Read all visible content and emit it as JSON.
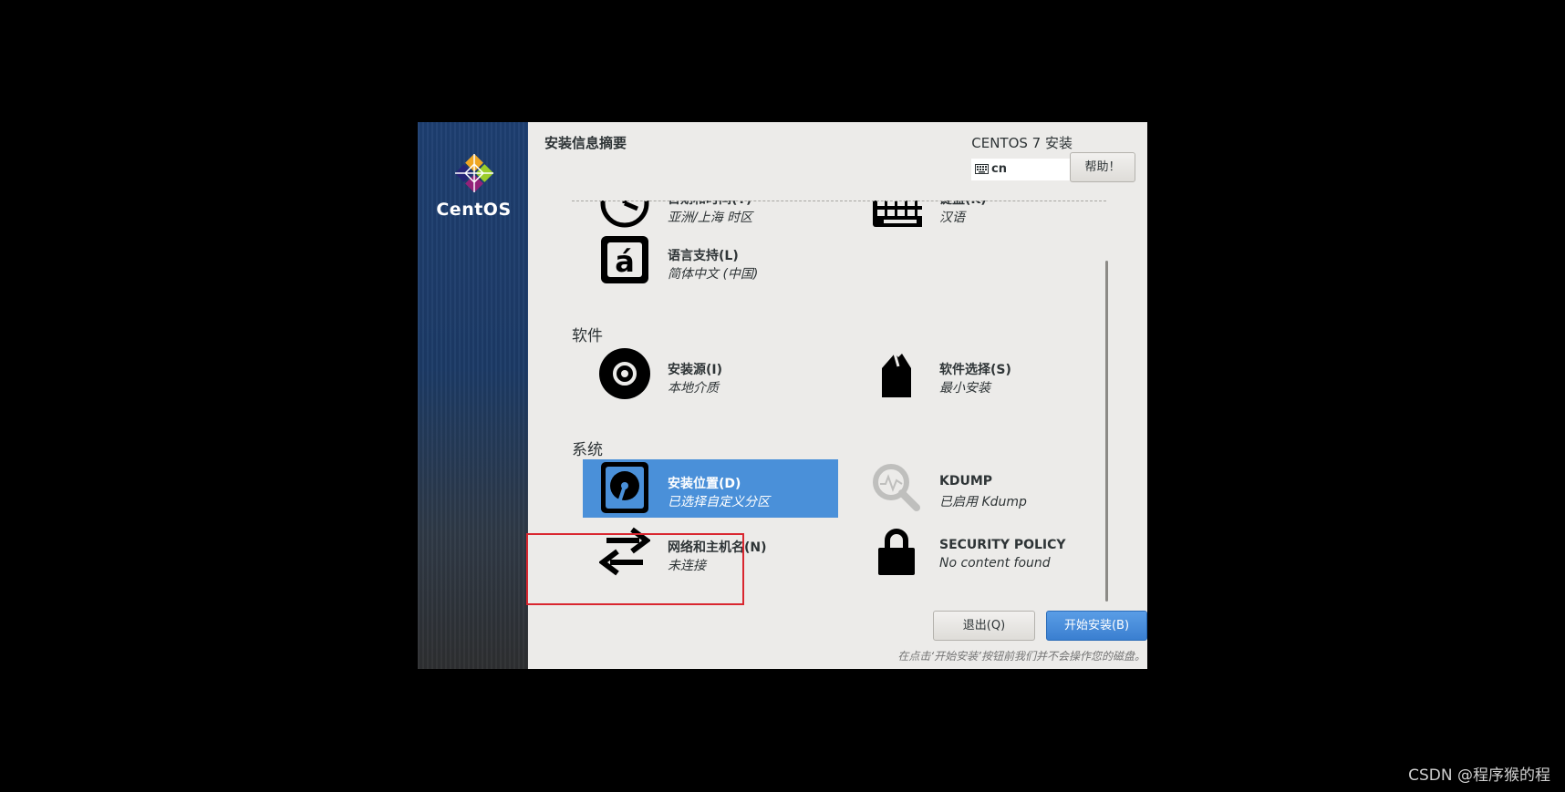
{
  "logo": {
    "text": "CentOS"
  },
  "header": {
    "title": "安装信息摘要",
    "product": "CENTOS 7 安装",
    "keyboard_layout": "cn",
    "help_label": "帮助！"
  },
  "localization": {
    "datetime": {
      "title": "日期和时间(T)",
      "status": "亚洲/上海 时区"
    },
    "keyboard": {
      "title": "键盘(K)",
      "status": "汉语"
    },
    "language": {
      "title": "语言支持(L)",
      "status": "简体中文 (中国)"
    }
  },
  "software": {
    "section": "软件",
    "source": {
      "title": "安装源(I)",
      "status": "本地介质"
    },
    "selection": {
      "title": "软件选择(S)",
      "status": "最小安装"
    }
  },
  "system": {
    "section": "系统",
    "destination": {
      "title": "安装位置(D)",
      "status": "已选择自定义分区"
    },
    "kdump": {
      "title": "KDUMP",
      "status": "已启用 Kdump"
    },
    "network": {
      "title": "网络和主机名(N)",
      "status": "未连接"
    },
    "security": {
      "title": "SECURITY POLICY",
      "status": "No content found"
    }
  },
  "actions": {
    "quit_label": "退出(Q)",
    "begin_label": "开始安装(B)",
    "note": "在点击‘开始安装’按钮前我们并不会操作您的磁盘。"
  },
  "watermark": "CSDN @程序猴的程",
  "colors": {
    "selected": "#4a90d9",
    "highlight_border": "#d9262f",
    "primary_button": "#3a7fd0"
  }
}
